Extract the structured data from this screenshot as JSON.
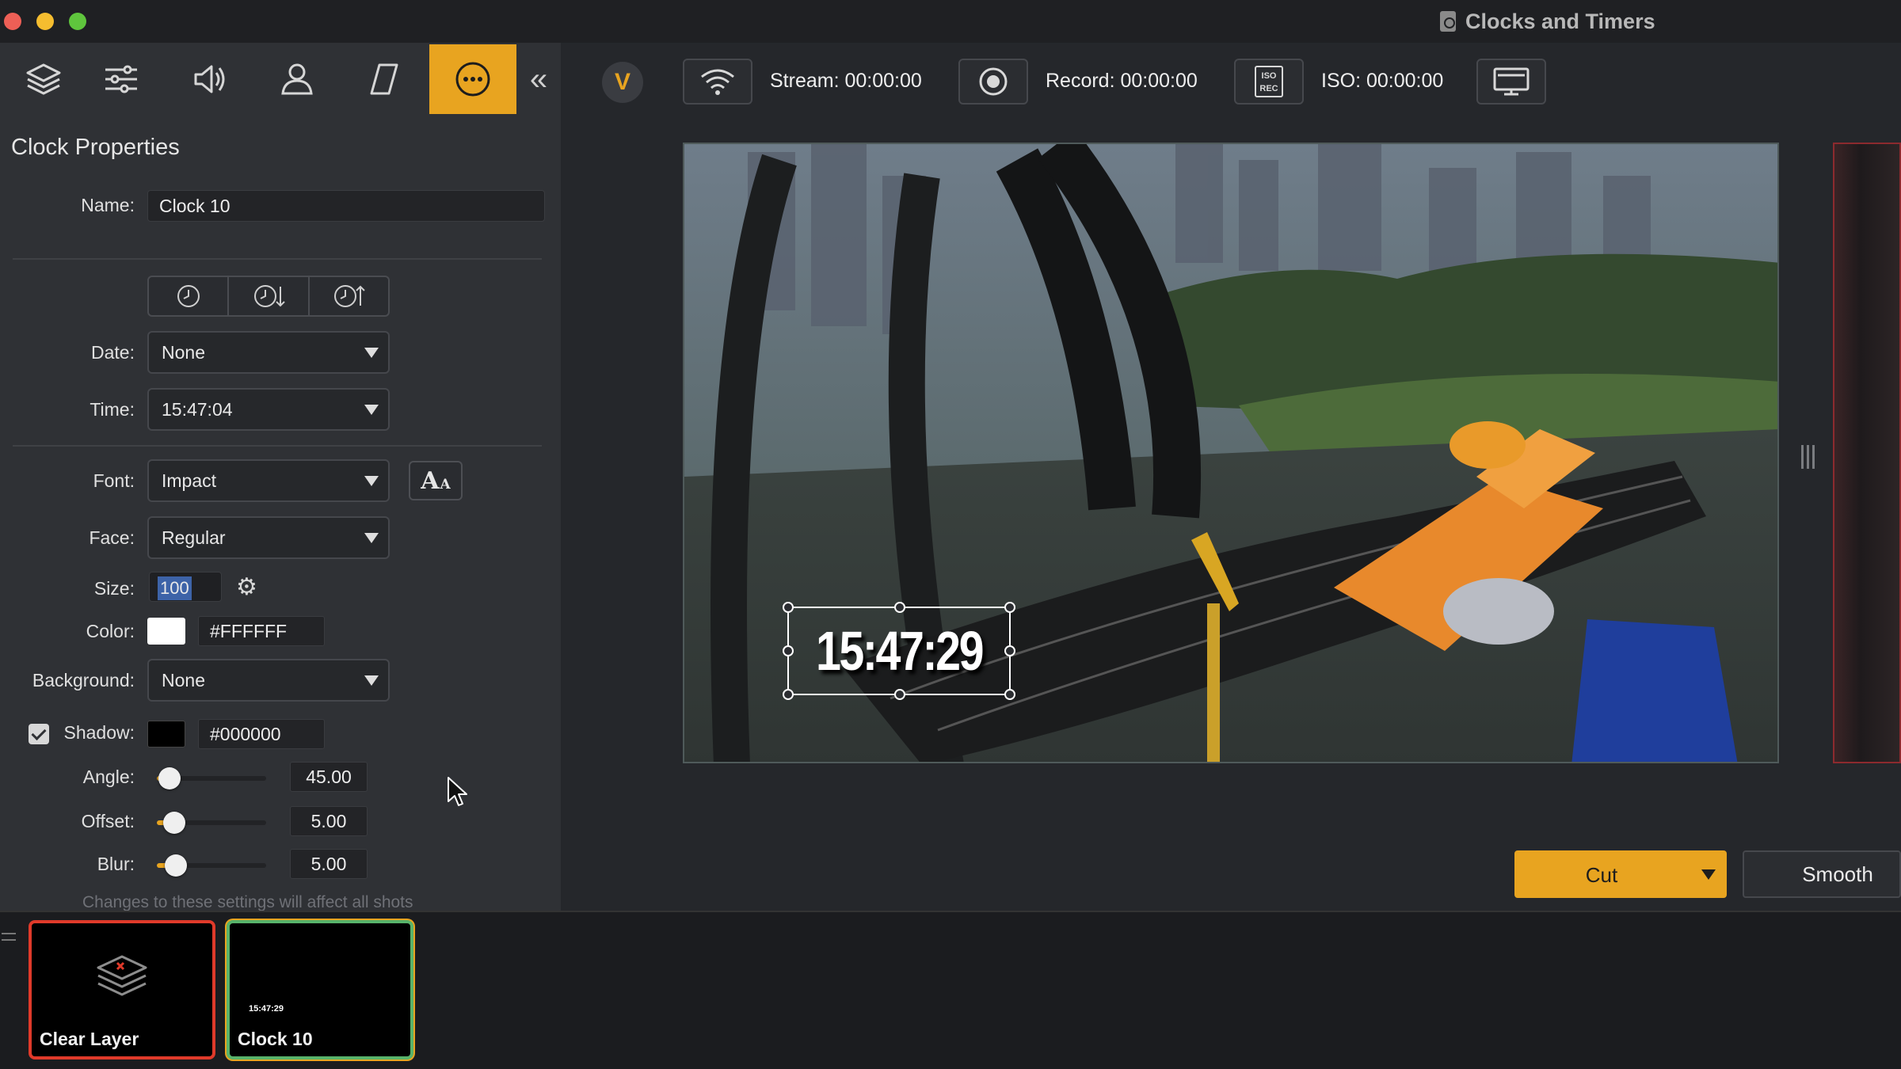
{
  "window": {
    "title": "Clocks and Timers"
  },
  "left_panel": {
    "tabs": [
      {
        "name": "layers",
        "icon": "layers-icon"
      },
      {
        "name": "adjustments",
        "icon": "sliders-icon"
      },
      {
        "name": "audio",
        "icon": "speaker-icon"
      },
      {
        "name": "person",
        "icon": "person-icon"
      },
      {
        "name": "shape",
        "icon": "parallelogram-icon"
      },
      {
        "name": "more",
        "icon": "more-icon",
        "active": true
      }
    ],
    "section_title": "Clock Properties",
    "name_label": "Name:",
    "name_value": "Clock 10",
    "clock_modes": [
      "clock-icon",
      "countdown-icon",
      "countup-icon"
    ],
    "date_label": "Date:",
    "date_value": "None",
    "time_label": "Time:",
    "time_value": "15:47:04",
    "font_label": "Font:",
    "font_value": "Impact",
    "face_label": "Face:",
    "face_value": "Regular",
    "size_label": "Size:",
    "size_value": "100",
    "color_label": "Color:",
    "color_hex": "#FFFFFF",
    "background_label": "Background:",
    "background_value": "None",
    "shadow_label": "Shadow:",
    "shadow_checked": true,
    "shadow_hex": "#000000",
    "angle_label": "Angle:",
    "angle_value": "45.00",
    "offset_label": "Offset:",
    "offset_value": "5.00",
    "blur_label": "Blur:",
    "blur_value": "5.00",
    "footnote": "Changes to these settings will affect all shots"
  },
  "toolbar": {
    "stream_label": "Stream: 00:00:00",
    "record_label": "Record: 00:00:00",
    "iso_icon_text": "ISO\nREC",
    "iso_label": "ISO: 00:00:00"
  },
  "preview": {
    "clock_text": "15:47:29"
  },
  "transition": {
    "cut_label": "Cut",
    "smooth_label": "Smooth"
  },
  "shots": [
    {
      "label": "Clear Layer"
    },
    {
      "label": "Clock 10",
      "mini_text": "15:47:29"
    }
  ],
  "colors": {
    "accent": "#E8A420",
    "clock_color": "#FFFFFF",
    "shadow_color": "#000000",
    "live_border": "#E03A2A",
    "preview_border": "#58B36A"
  }
}
